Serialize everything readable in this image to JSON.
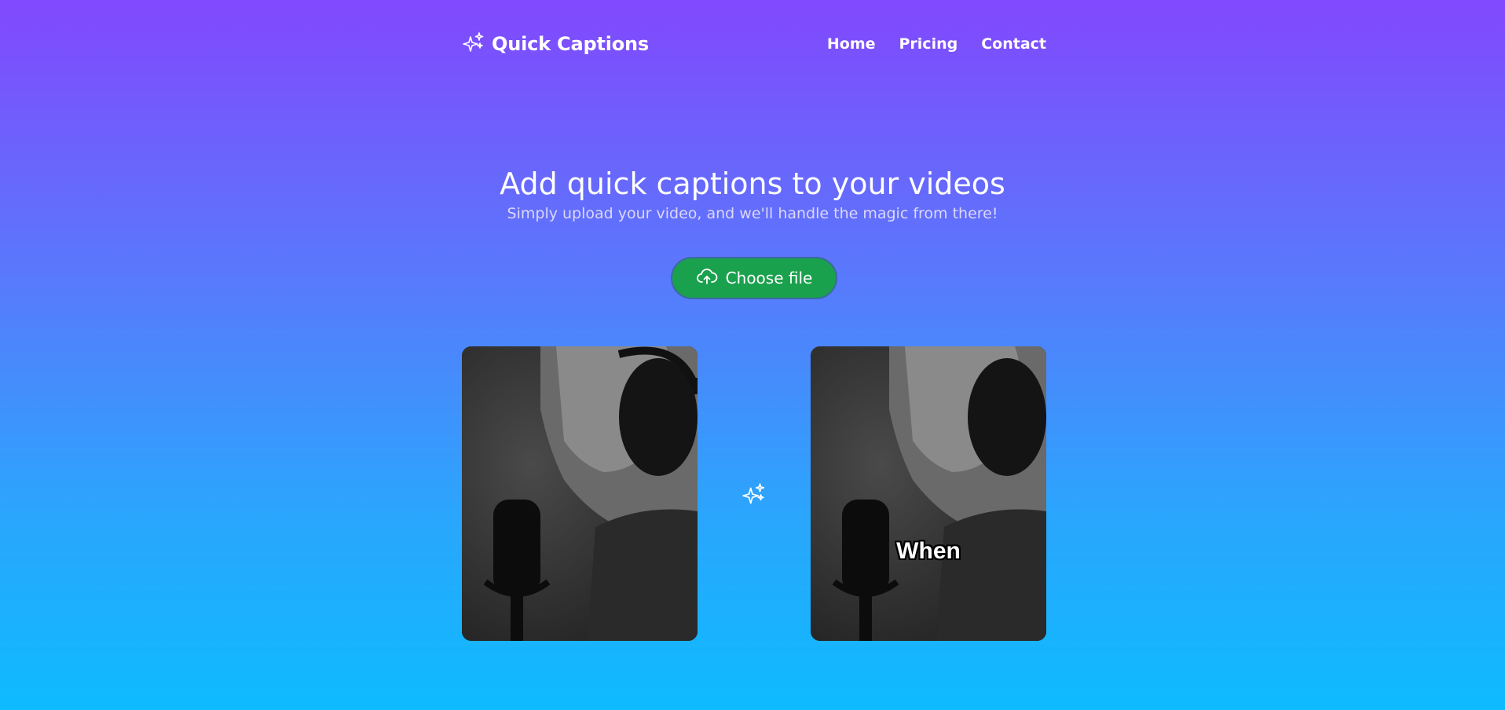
{
  "header": {
    "logo_text": "Quick Captions",
    "logo_icon": "sparkles-icon",
    "nav": [
      {
        "label": "Home"
      },
      {
        "label": "Pricing"
      },
      {
        "label": "Contact"
      }
    ]
  },
  "hero": {
    "title": "Add quick captions to your videos",
    "subtitle": "Simply upload your video, and we'll handle the magic from there!"
  },
  "upload": {
    "button_label": "Choose file",
    "button_icon": "cloud-upload-icon",
    "button_color": "#1aa14d"
  },
  "preview": {
    "left_video": "original-video-preview",
    "right_video": "captioned-video-preview",
    "caption_word": "When",
    "divider_icon": "sparkles-icon"
  },
  "colors": {
    "gradient_top": "#8248fd",
    "gradient_bottom": "#0ebbfe"
  }
}
